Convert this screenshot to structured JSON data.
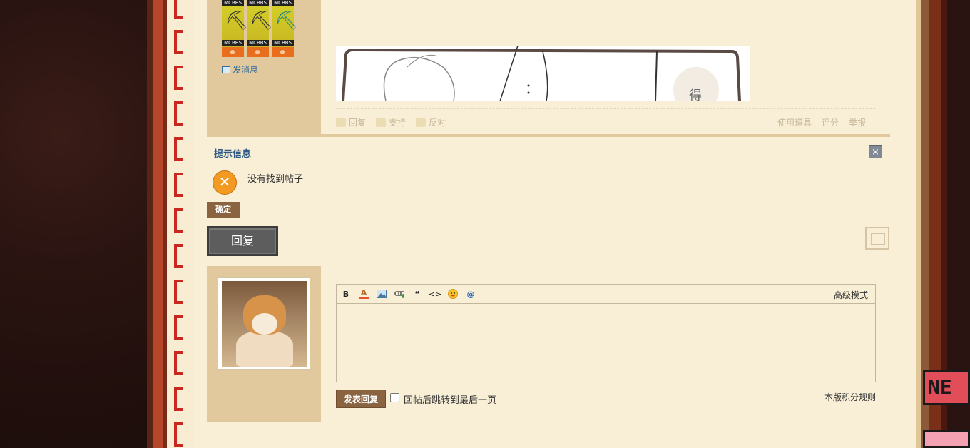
{
  "post": {
    "medals": [
      {
        "top": "MCBBS",
        "bottom": "MCBBS",
        "icon": "pickaxe-icon",
        "color": "#333333"
      },
      {
        "top": "MCBBS",
        "bottom": "MCBBS",
        "icon": "pickaxe-icon",
        "color": "#333333"
      },
      {
        "top": "MCBBS",
        "bottom": "MCBBS",
        "icon": "diamond-pickaxe-icon",
        "color": "#1b8a8a"
      }
    ],
    "send_message": "发消息",
    "actions": {
      "reply": "回复",
      "support": "支持",
      "oppose": "反对",
      "use_tool": "使用道具",
      "rate": "评分",
      "report": "举报"
    }
  },
  "notice": {
    "title": "提示信息",
    "close": "×",
    "message": "没有找到帖子",
    "confirm": "确定"
  },
  "reply_button": "回复",
  "editor": {
    "advanced_mode": "高级模式",
    "tools": {
      "bold": "B",
      "color": "A",
      "quote": "“",
      "code": "<>",
      "mention": "@"
    },
    "submit": "发表回复",
    "jump_label": "回帖后跳转到最后一页",
    "rules": "本版积分规则"
  },
  "badge": {
    "text": "NE"
  },
  "colors": {
    "paper": "#f8efd6",
    "sidebar": "#e1c99d",
    "button_brown": "#8a6440",
    "link_blue": "#2d5a86",
    "stitch_red": "#c8281f"
  }
}
